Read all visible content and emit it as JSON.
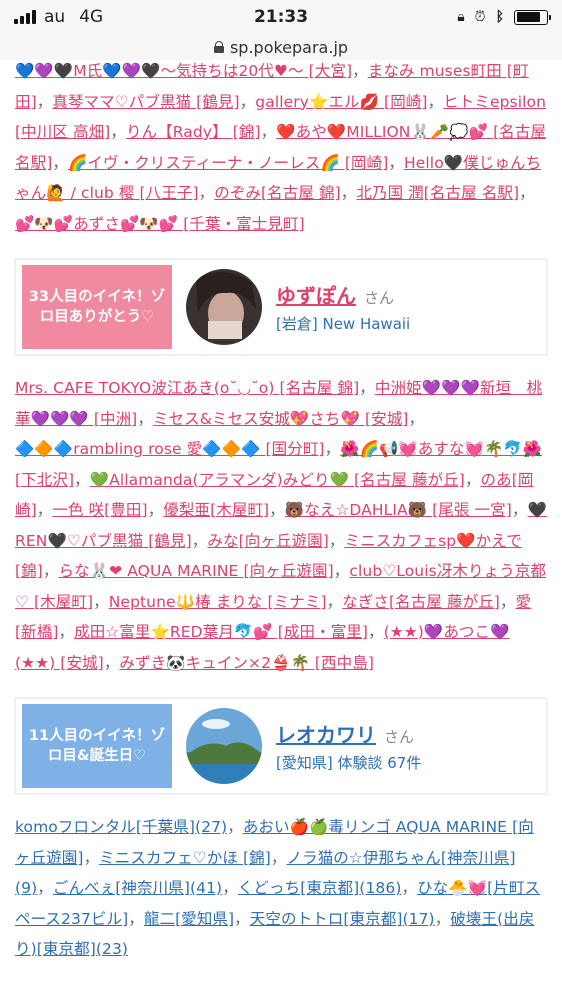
{
  "status_bar": {
    "carrier": "au",
    "network": "4G",
    "time": "21:33",
    "icons": [
      "rotation-lock-icon",
      "alarm-icon",
      "bluetooth-icon",
      "battery-icon"
    ]
  },
  "address_bar": {
    "url": "sp.pokepara.jp"
  },
  "section1_links": [
    "💙💜🖤M氏💙💜🖤～気持ちは20代♥～ [大宮]",
    "まなみ muses町田 [町田]",
    "真琴ママ♡パブ黒猫 [鶴見]",
    "gallery⭐エル💋 [岡崎]",
    "ヒトミepsilon [中川区 高畑]",
    "りん【Rady】 [錦]",
    "❤️あや❤️MILLION🐰🥕💭💕 [名古屋 名駅]",
    "🌈イヴ・クリスティーナ・ノーレス🌈 [岡崎]",
    "Hello🖤僕じゅんちゃん🙋 / club 樱 [八王子]",
    "のぞみ[名古屋 錦]",
    "北乃国 潤[名古屋 名駅]",
    "💕🐶💕あずさ💕🐶💕 [千葉・富士見町]"
  ],
  "card1": {
    "badge": "33人目のイイネ！ゾロ目ありがとう♡",
    "name": "ゆずぽん",
    "honorific": "さん",
    "sub": "[岩倉] New Hawaii"
  },
  "section2_links": [
    "Mrs. CAFE TOKYO波江あき(o˘◡˘o) [名古屋 錦]",
    "中洲姫💜💜💜新垣　桃華💜💜💜 [中洲]",
    "ミセス&ミセス安城💖さち💖 [安城]",
    "🔷🔶🔷rambling rose 愛🔷🔶🔷 [国分町]",
    "🌺🌈📢💓あすな💓🌴🐬🌺 [下北沢]",
    "💚Allamanda(アラマンダ)みどり💚 [名古屋 藤が丘]",
    "のあ[岡崎]",
    "一色 咲[豊田]",
    "優梨亜[木屋町]",
    "🐻なえ☆DAHLIA🐻 [尾張 一宮]",
    "🖤REN🖤♡パブ黒猫 [鶴見]",
    "みな[向ヶ丘遊園]",
    "ミニスカフェsp❤️かえで [錦]",
    "らな🐰❤ AQUA MARINE [向ヶ丘遊園]",
    "club♡Louis冴木りょう京都♡ [木屋町]",
    "Neptune🔱椿 まりな [ミナミ]",
    "なぎさ[名古屋 藤が丘]",
    "愛[新橋]",
    "成田☆富里⭐RED葉月🐬💕 [成田・富里]",
    "(★★)💜あつこ💜(★★) [安城]",
    "みずき🐼キュイン×2👙🌴 [西中島]"
  ],
  "card2": {
    "badge": "11人目のイイネ！ゾロ目&誕生日♡",
    "name": "レオカワリ",
    "honorific": "さん",
    "sub": "[愛知県] 体験談 67件"
  },
  "section3_links": [
    "komoフロンタル[千葉県](27)",
    "あおい🍎🍏毒リンゴ AQUA MARINE [向ヶ丘遊園]",
    "ミニスカフェ♡かほ [錦]",
    "ノラ猫の☆伊那ちゃん[神奈川県](9)",
    "ごんべぇ[神奈川県](41)",
    "くどっち[東京都](186)",
    "ひな🐣💓[片町スペース237ビル]",
    "龍二[愛知県]",
    "天空のトトロ[東京都](17)",
    "破壊王(出戻り)[東京都](23)"
  ],
  "separator": "，",
  "colors": {
    "link_pink": "#e0406c",
    "link_blue": "#2f6fb5",
    "badge_pink": "#f08aa0",
    "badge_blue": "#7fb0e6"
  }
}
